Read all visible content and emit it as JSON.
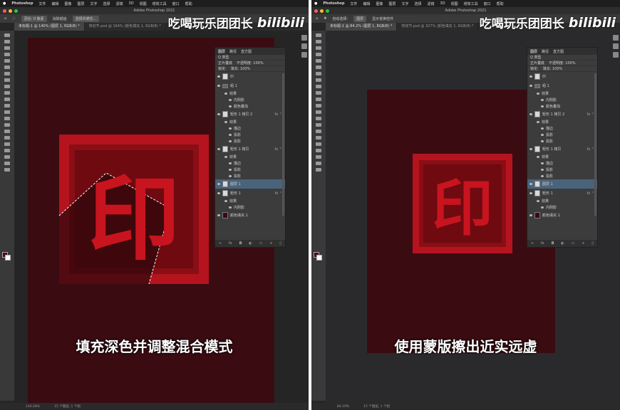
{
  "app": {
    "menubar": [
      "Photoshop",
      "文件",
      "编辑",
      "图像",
      "图层",
      "文字",
      "选择",
      "滤镜",
      "3D",
      "视图",
      "增效工具",
      "窗口",
      "帮助"
    ],
    "title": "Adobe Photoshop 2021"
  },
  "watermark": {
    "text": "吃喝玩乐团团长",
    "logo": "bilibili"
  },
  "left": {
    "options": [
      "羽化: 0 像素",
      "消除锯齿",
      "选择并遮住..."
    ],
    "tabs": [
      "未标题-1 @ 140% (图层 1, RGB/8) *",
      "劳动节.psd @ 164% (颜色填充 1, RGB/8) *"
    ],
    "subtitle": "填充深色并调整混合模式",
    "zoom": "140.28%",
    "status": "15 个图层, 1 个组",
    "blend_mode": "正片叠底",
    "opacity": "不透明度: 100%"
  },
  "right": {
    "options": [
      "自动选择:",
      "图层",
      "显示变换控件"
    ],
    "tabs": [
      "未标题-1 @ 84.2% (图层 1, RGB/8) *",
      "劳动节.psd @ 327% (颜色填充 1, RGB/8) *"
    ],
    "subtitle": "使用蒙版擦出近实远虚",
    "zoom": "84.19%",
    "status": "15 个图层, 1 个组",
    "blend_mode": "正片叠底",
    "opacity": "不透明度: 100%"
  },
  "panel": {
    "tabs": [
      "图层",
      "路径",
      "直方图"
    ],
    "kind": "Q 类型",
    "lock": "锁定:",
    "fill": "填充: 100%",
    "layers": [
      {
        "name": "印",
        "kind": "main"
      },
      {
        "name": "组 1",
        "kind": "group"
      },
      {
        "name": "效果",
        "kind": "sub"
      },
      {
        "name": "内阴影",
        "kind": "sub2"
      },
      {
        "name": "颜色叠加",
        "kind": "sub2"
      },
      {
        "name": "矩形 1 拷贝 2",
        "kind": "main"
      },
      {
        "name": "效果",
        "kind": "sub"
      },
      {
        "name": "描边",
        "kind": "sub2"
      },
      {
        "name": "投影",
        "kind": "sub2"
      },
      {
        "name": "投影",
        "kind": "sub2"
      },
      {
        "name": "矩形 1 拷贝",
        "kind": "main"
      },
      {
        "name": "效果",
        "kind": "sub"
      },
      {
        "name": "描边",
        "kind": "sub2"
      },
      {
        "name": "投影",
        "kind": "sub2"
      },
      {
        "name": "投影",
        "kind": "sub2"
      },
      {
        "name": "图层 1",
        "kind": "selected"
      },
      {
        "name": "矩形 1",
        "kind": "main"
      },
      {
        "name": "效果",
        "kind": "sub"
      },
      {
        "name": "内阴影",
        "kind": "sub2"
      },
      {
        "name": "颜色填充 1",
        "kind": "main"
      }
    ]
  },
  "canvas": {
    "glyph": "印"
  },
  "colors": {
    "doc_bg": "#3b0b12",
    "frame_red": "#b5141e",
    "selection_blue": "#49637a"
  }
}
